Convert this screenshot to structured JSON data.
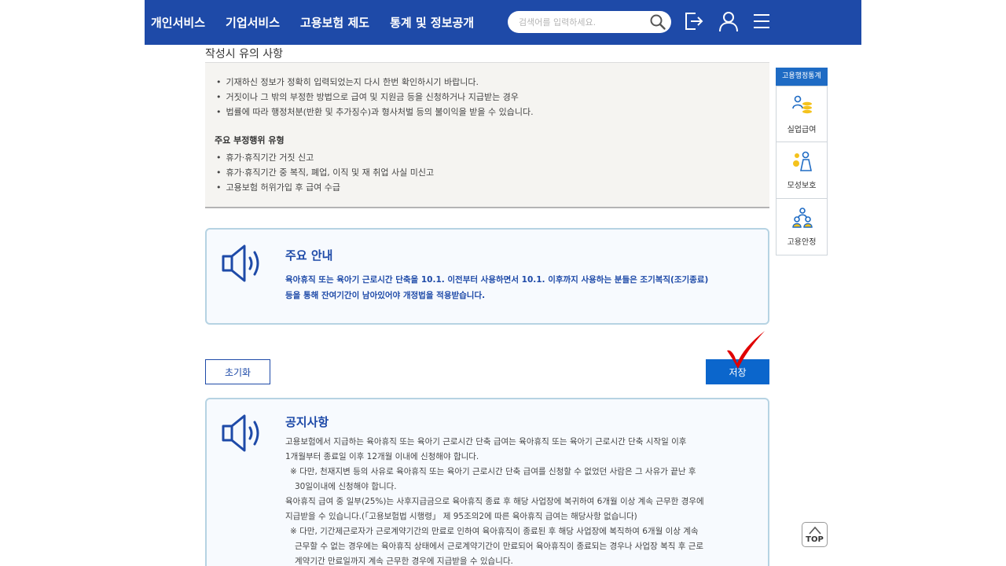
{
  "header": {
    "nav": [
      "개인서비스",
      "기업서비스",
      "고용보험 제도",
      "통계 및 정보공개"
    ],
    "search_placeholder": "검색어를 입력하세요."
  },
  "notes": {
    "title": "작성시 유의 사항",
    "items": [
      "기재하신 정보가 정확히 입력되었는지 다시 한번 확인하시기 바랍니다.",
      "거짓이나 그 밖의 부정한 방법으로 급여 및 지원금 등을 신청하거나 지급받는 경우",
      "법률에 따라 행정처분(반환 및 추가징수)과 형사처벌 등의 불이익을 받을 수 있습니다."
    ],
    "subtitle": "주요 부정행위 유형",
    "sub_items": [
      "휴가·휴직기간 거짓 신고",
      "휴가·휴직기간 중 복직, 폐업, 이직 및 재 취업 사실 미신고",
      "고용보험 허위가입 후 급여 수급"
    ]
  },
  "main_notice": {
    "title": "주요 안내",
    "lines": [
      "육아휴직 또는 육아기 근로시간 단축을 10.1. 이전부터 사용하면서 10.1. 이후까지 사용하는 분들은 조기복직(조기종료)",
      "등을 통해 잔여기간이 남아있어야 개정법을 적용받습니다."
    ]
  },
  "buttons": {
    "reset": "초기화",
    "save": "저장"
  },
  "announcement": {
    "title": "공지사항",
    "lines": [
      "고용보험에서 지급하는 육아휴직 또는 육아기 근로시간 단축 급여는 육아휴직 또는 육아기 근로시간 단축 시작일 이후",
      "1개월부터 종료일 이후 12개월 이내에 신청해야 합니다.",
      "※ 다만, 천재지변 등의 사유로 육아휴직 또는 육아기 근로시간 단축 급여를 신청할 수 없었던 사람은 그 사유가 끝난 후",
      "30일이내에 신청해야 합니다.",
      "육아휴직 급여 중 일부(25%)는 사후지급금으로 육아휴직 종료 후 해당 사업장에 복귀하여 6개월 이상 계속 근무한 경우에",
      "지급받을 수 있습니다.(「고용보험법 시행령」 제 95조의2에 따른 육아휴직 급여는 해당사항 없습니다)",
      "※ 다만, 기간제근로자가 근로계약기간의 만료로 인하여 육아휴직이 종료된 후 해당 사업장에 복직하여 6개월 이상 계속",
      "근무할 수 없는 경우에는 육아휴직 상태에서 근로계약기간이 만료되어 육아휴직이 종료되는 경우나 사업장 복직 후 근로",
      "계약기간 만료일까지 계속 근무한 경우에 지급받을 수 있습니다."
    ]
  },
  "quick_menu": {
    "title": "고용행정통계",
    "items": [
      {
        "label": "실업급여",
        "icon": "coins-person-icon"
      },
      {
        "label": "모성보호",
        "icon": "mother-child-icon"
      },
      {
        "label": "고용안정",
        "icon": "group-icon"
      }
    ]
  },
  "top_label": "TOP",
  "colors": {
    "header": "#1e4aa8",
    "accent": "#0b66cc",
    "check": "#e00000"
  }
}
